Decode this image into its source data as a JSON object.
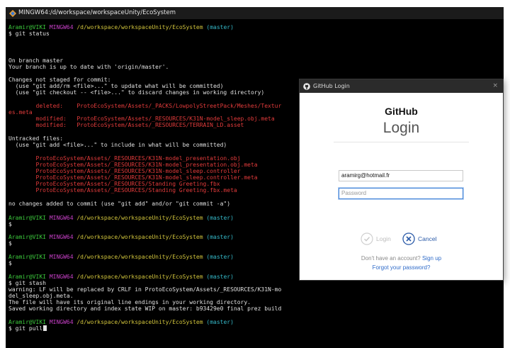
{
  "terminal": {
    "title": "MINGW64:/d/workspace/workspaceUnity/EcoSystem",
    "prompt_user": "Aramir@VIKI",
    "prompt_shell": "MINGW64",
    "prompt_path": "/d/workspace/workspaceUnity/EcoSystem",
    "prompt_branch": "(master)",
    "lines": {
      "cmd_status": "$ git status",
      "on_branch": "On branch master",
      "up_to_date": "Your branch is up to date with 'origin/master'.",
      "not_staged_header": "Changes not staged for commit:",
      "hint_add": "  (use \"git add/rm <file>...\" to update what will be committed)",
      "hint_checkout": "  (use \"git checkout -- <file>...\" to discard changes in working directory)",
      "deleted_a": "        deleted:    ProtoEcoSystem/Assets/_PACKS/LowpolyStreetPack/Meshes/Textur",
      "deleted_b": "es.meta",
      "modified_1": "        modified:   ProtoEcoSystem/Assets/_RESOURCES/K31N-model_sleep.obj.meta",
      "modified_2": "        modified:   ProtoEcoSystem/Assets/_RESOURCES/TERRAIN_LD.asset",
      "untracked_header": "Untracked files:",
      "hint_untracked": "  (use \"git add <file>...\" to include in what will be committed)",
      "untracked": [
        "        ProtoEcoSystem/Assets/_RESOURCES/K31N-model_presentation.obj",
        "        ProtoEcoSystem/Assets/_RESOURCES/K31N-model_presentation.obj.meta",
        "        ProtoEcoSystem/Assets/_RESOURCES/K31N-model_sleep.controller",
        "        ProtoEcoSystem/Assets/_RESOURCES/K31N-model_sleep.controller.meta",
        "        ProtoEcoSystem/Assets/_RESOURCES/Standing Greeting.fbx",
        "        ProtoEcoSystem/Assets/_RESOURCES/Standing Greeting.fbx.meta"
      ],
      "no_changes": "no changes added to commit (use \"git add\" and/or \"git commit -a\")",
      "dollar": "$",
      "cmd_stash": "$ git stash",
      "warn_1": "warning: LF will be replaced by CRLF in ProtoEcoSystem/Assets/_RESOURCES/K31N-mo",
      "warn_2": "del_sleep.obj.meta.",
      "warn_3": "The file will have its original line endings in your working directory.",
      "saved": "Saved working directory and index state WIP on master: b93429e0 final prez build",
      "cmd_pull": "$ git pull"
    }
  },
  "github_login": {
    "window_title": "GitHub Login",
    "close_glyph": "×",
    "brand": "GitHub",
    "heading": "Login",
    "email_value": "aramirg@hotmail.fr",
    "password_placeholder": "Password",
    "login_label": "Login",
    "cancel_label": "Cancel",
    "no_account_text": "Don't have an account?",
    "sign_up_label": "Sign up",
    "forgot_label": "Forgot your password?",
    "icons": {
      "window": "github-octocat-icon",
      "login": "checkmark-circle-icon",
      "cancel": "x-circle-icon"
    }
  },
  "colors": {
    "term_bg": "#000000",
    "prompt_user": "#3cc93c",
    "prompt_shell": "#c840c8",
    "prompt_path": "#d2c53c",
    "prompt_branch": "#35b9c9",
    "git_red": "#e23b3b",
    "link_blue": "#2f6bc9"
  }
}
